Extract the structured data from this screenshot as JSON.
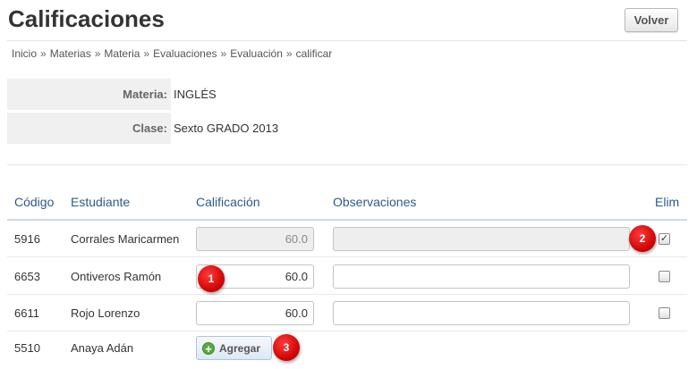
{
  "page": {
    "title": "Calificaciones",
    "back_label": "Volver"
  },
  "breadcrumb": [
    "Inicio",
    "Materias",
    "Materia",
    "Evaluaciones",
    "Evaluación",
    "calificar"
  ],
  "breadcrumb_separator": "»",
  "info": {
    "materia_label": "Materia:",
    "materia_value": "INGLÉS",
    "clase_label": "Clase:",
    "clase_value": "Sexto GRADO 2013"
  },
  "table": {
    "headers": {
      "codigo": "Código",
      "estudiante": "Estudiante",
      "calificacion": "Calificación",
      "observaciones": "Observaciones",
      "elim": "Elim"
    },
    "rows": [
      {
        "code": "5916",
        "name": "Corrales Maricarmen",
        "grade": "60.0",
        "observation": "",
        "disabled": true,
        "elim_checked": true,
        "elim_mark": "✓"
      },
      {
        "code": "6653",
        "name": "Ontiveros Ramón",
        "grade": "60.0",
        "observation": "",
        "disabled": false,
        "elim_checked": false
      },
      {
        "code": "6611",
        "name": "Rojo Lorenzo",
        "grade": "60.0",
        "observation": "",
        "disabled": false,
        "elim_checked": false
      },
      {
        "code": "5510",
        "name": "Anaya Adán",
        "add_label": "Agregar"
      }
    ]
  },
  "markers": [
    "1",
    "2",
    "3"
  ],
  "icons": {
    "add": "plus-circle-icon",
    "check": "check-icon"
  },
  "colors": {
    "header_text": "#2d5a8c",
    "marker": "#cc0000",
    "add_icon": "#5aa83e"
  }
}
